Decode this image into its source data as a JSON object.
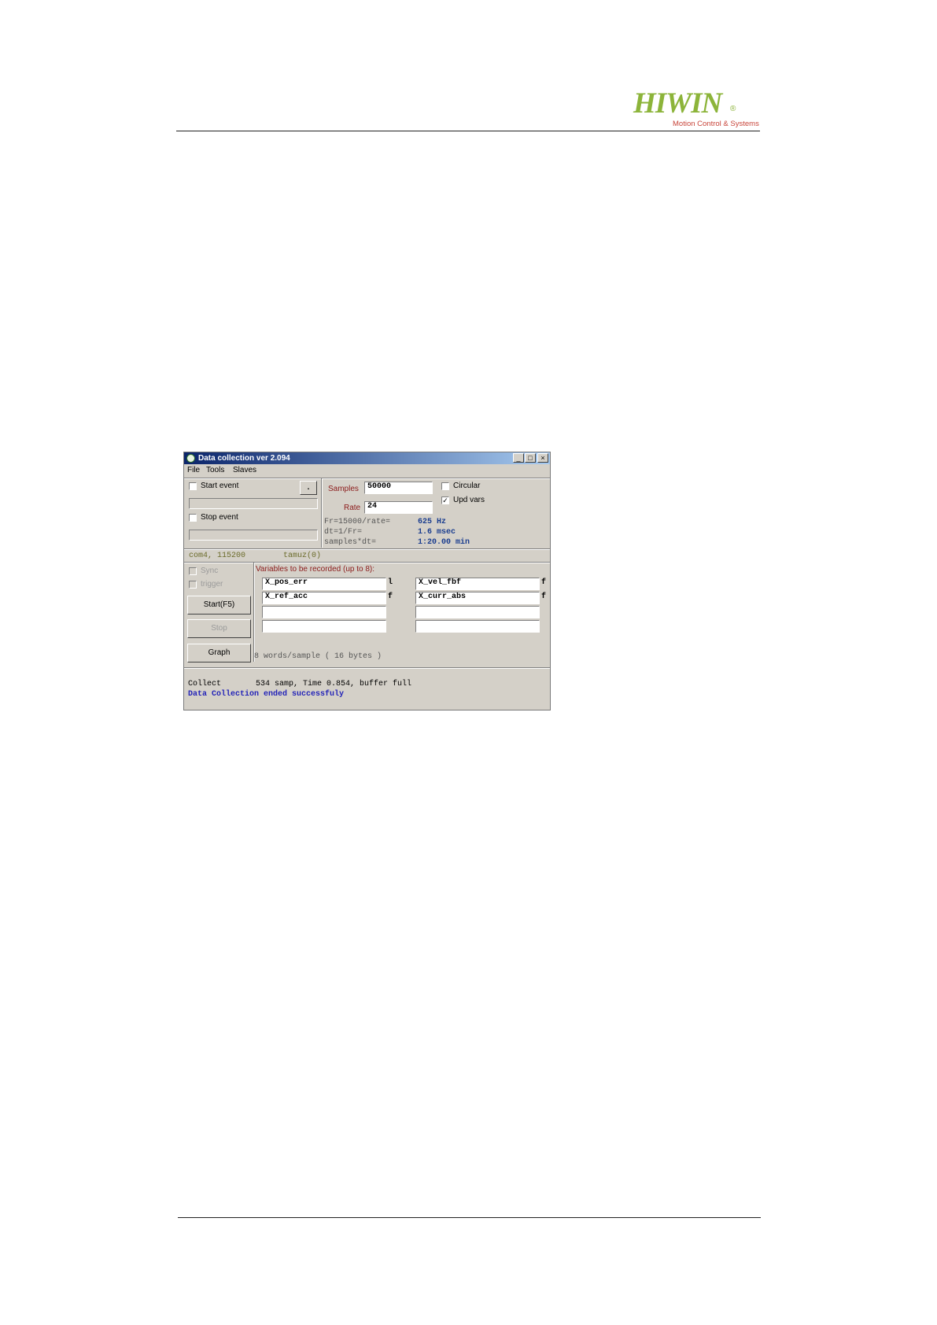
{
  "brand": {
    "name": "HIWIN",
    "registered": "®",
    "tagline": "Motion Control & Systems",
    "color": "#8cb43a",
    "tagline_color": "#c8453a"
  },
  "window": {
    "title": "Data collection ver 2.094",
    "title_icon": "app-icon",
    "controls": {
      "minimize": "_",
      "maximize": "□",
      "close": "×"
    },
    "menu": [
      "File",
      "Tools",
      "Slaves"
    ]
  },
  "events": {
    "start_event_label": "Start event",
    "start_event_checked": false,
    "picker_label": ".",
    "stop_event_label": "Stop event",
    "stop_event_checked": false
  },
  "sampling": {
    "samples_label": "Samples",
    "samples_value": "50000",
    "rate_label": "Rate",
    "rate_value": "24",
    "circular_label": "Circular",
    "circular_checked": false,
    "upd_vars_label": "Upd vars",
    "upd_vars_checked": true,
    "calc": [
      {
        "expr": "Fr=15000/rate=",
        "value": "625 Hz"
      },
      {
        "expr": "dt=1/Fr=",
        "value": "1.6 msec"
      },
      {
        "expr": "samples*dt=",
        "value": "1:20.00 min"
      }
    ]
  },
  "connection": {
    "port": "com4, 115200",
    "device": "tamuz(0)"
  },
  "controls": {
    "sync_label": "Sync",
    "trigger_label": "trigger",
    "start_button": "Start(F5)",
    "stop_button": "Stop",
    "graph_button": "Graph"
  },
  "variables": {
    "heading": "Variables to be recorded (up to 8):",
    "left": [
      {
        "name": "X_pos_err",
        "type": "l"
      },
      {
        "name": "X_ref_acc",
        "type": "f"
      },
      {
        "name": "",
        "type": ""
      },
      {
        "name": "",
        "type": ""
      }
    ],
    "right": [
      {
        "name": "X_vel_fbf",
        "type": "f"
      },
      {
        "name": "X_curr_abs",
        "type": "f"
      },
      {
        "name": "",
        "type": ""
      },
      {
        "name": "",
        "type": ""
      }
    ],
    "footer": "8 words/sample ( 16 bytes )"
  },
  "status": {
    "line1_label": "Collect",
    "line1_value": "534 samp, Time 0.854, buffer full",
    "line2": "Data Collection ended successfuly"
  }
}
